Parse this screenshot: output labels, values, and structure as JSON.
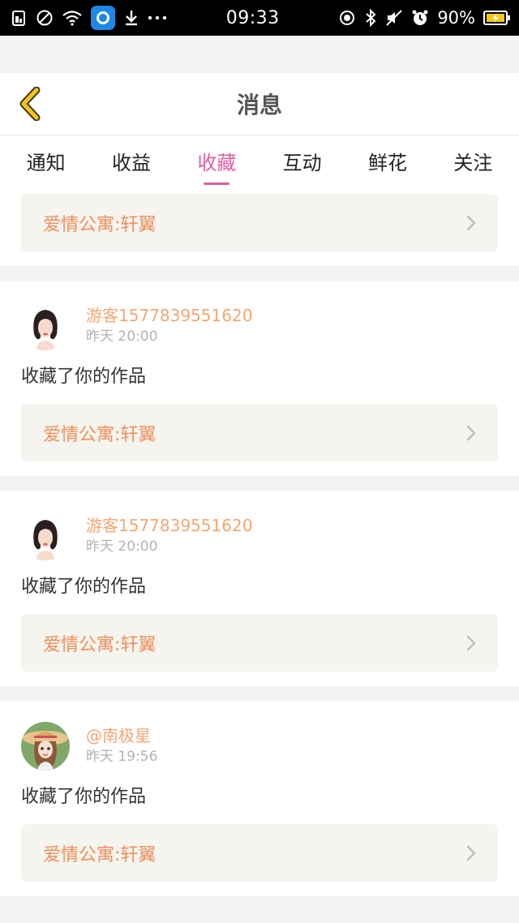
{
  "status_bar": {
    "time": "09:33",
    "battery_percent": "90%",
    "left_icons": [
      "sim-icon",
      "no-sim-icon",
      "wifi-icon",
      "app-notification-icon",
      "download-icon",
      "more-icon"
    ],
    "right_icons": [
      "location-icon",
      "bluetooth-icon",
      "mute-icon",
      "alarm-icon",
      "battery-charging-icon"
    ]
  },
  "header": {
    "title": "消息",
    "back_icon": "chevron-left-icon",
    "back_color": "#f5c518"
  },
  "tabs": {
    "items": [
      {
        "label": "通知"
      },
      {
        "label": "收益"
      },
      {
        "label": "收藏",
        "active": true
      },
      {
        "label": "互动"
      },
      {
        "label": "鲜花"
      },
      {
        "label": "关注"
      }
    ],
    "active_color": "#e060a0"
  },
  "feed": {
    "partial_card": {
      "work_title": "爱情公寓:轩翼"
    },
    "items": [
      {
        "username": "游客1577839551620",
        "time": "昨天 20:00",
        "action": "收藏了你的作品",
        "work_title": "爱情公寓:轩翼",
        "avatar": "girl-avatar"
      },
      {
        "username": "游客1577839551620",
        "time": "昨天 20:00",
        "action": "收藏了你的作品",
        "work_title": "爱情公寓:轩翼",
        "avatar": "girl-avatar"
      },
      {
        "username": "@南极星",
        "time": "昨天 19:56",
        "action": "收藏了你的作品",
        "work_title": "爱情公寓:轩翼",
        "avatar": "anime-girl-avatar"
      }
    ]
  },
  "colors": {
    "username": "#f2a774",
    "work_title": "#f08f5c",
    "work_bg": "#f5f4ee",
    "page_bg": "#f3f3f3"
  }
}
